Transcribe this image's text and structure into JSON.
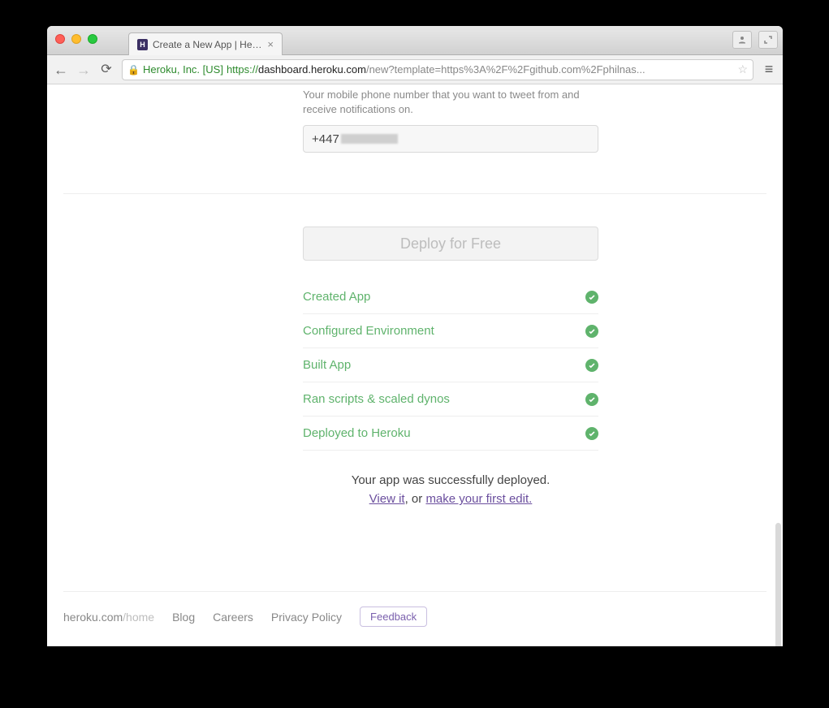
{
  "window": {
    "tab_title": "Create a New App | Heroku",
    "favicon_text": "H"
  },
  "browser": {
    "org": "Heroku, Inc. [US]",
    "protocol": "https://",
    "host": "dashboard.heroku.com",
    "path": "/new?template=https%3A%2F%2Fgithub.com%2Fphilnas..."
  },
  "form": {
    "phone_help": "Your mobile phone number that you want to tweet from and receive notifications on.",
    "phone_value_prefix": "+447"
  },
  "deploy": {
    "button_label": "Deploy for Free",
    "steps": [
      "Created App",
      "Configured Environment",
      "Built App",
      "Ran scripts & scaled dynos",
      "Deployed to Heroku"
    ],
    "success_line": "Your app was successfully deployed.",
    "view_link": "View it",
    "between_text": ", or ",
    "edit_link": "make your first edit."
  },
  "footer": {
    "brand": "heroku.com",
    "brand_path": "/home",
    "links": [
      "Blog",
      "Careers",
      "Privacy Policy"
    ],
    "feedback": "Feedback"
  }
}
